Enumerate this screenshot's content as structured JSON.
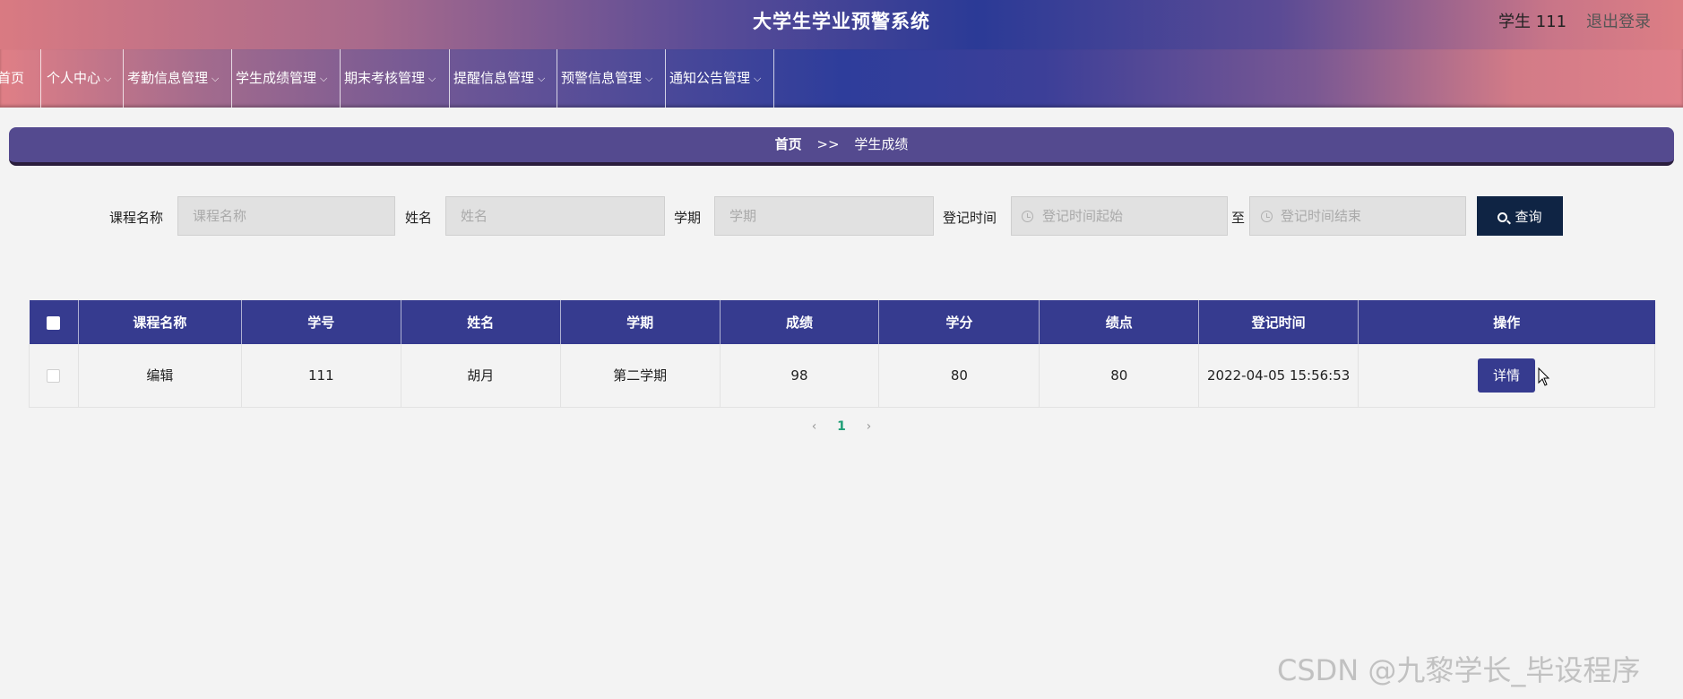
{
  "header": {
    "app_title": "大学生学业预警系统",
    "user_name": "学生 111",
    "logout": "退出登录"
  },
  "nav": {
    "items": [
      {
        "label": "首页"
      },
      {
        "label": "个人中心"
      },
      {
        "label": "考勤信息管理"
      },
      {
        "label": "学生成绩管理"
      },
      {
        "label": "期末考核管理"
      },
      {
        "label": "提醒信息管理"
      },
      {
        "label": "预警信息管理"
      },
      {
        "label": "通知公告管理"
      }
    ]
  },
  "breadcrumb": {
    "home": "首页",
    "separator": ">>",
    "current": "学生成绩"
  },
  "filters": {
    "course_label": "课程名称",
    "course_placeholder": "课程名称",
    "name_label": "姓名",
    "name_placeholder": "姓名",
    "term_label": "学期",
    "term_placeholder": "学期",
    "time_label": "登记时间",
    "time_start_placeholder": "登记时间起始",
    "to_label": "至",
    "time_end_placeholder": "登记时间结束",
    "search_button": "查询"
  },
  "table": {
    "columns": [
      "课程名称",
      "学号",
      "姓名",
      "学期",
      "成绩",
      "学分",
      "绩点",
      "登记时间",
      "操作"
    ],
    "rows": [
      {
        "course": "编辑",
        "student_id": "111",
        "name": "胡月",
        "term": "第二学期",
        "score": "98",
        "credit": "80",
        "gpa": "80",
        "time": "2022-04-05 15:56:53",
        "action": "详情"
      }
    ]
  },
  "pagination": {
    "prev": "‹",
    "current_page": "1",
    "next": "›"
  },
  "watermark": "CSDN @九黎学长_毕设程序"
}
